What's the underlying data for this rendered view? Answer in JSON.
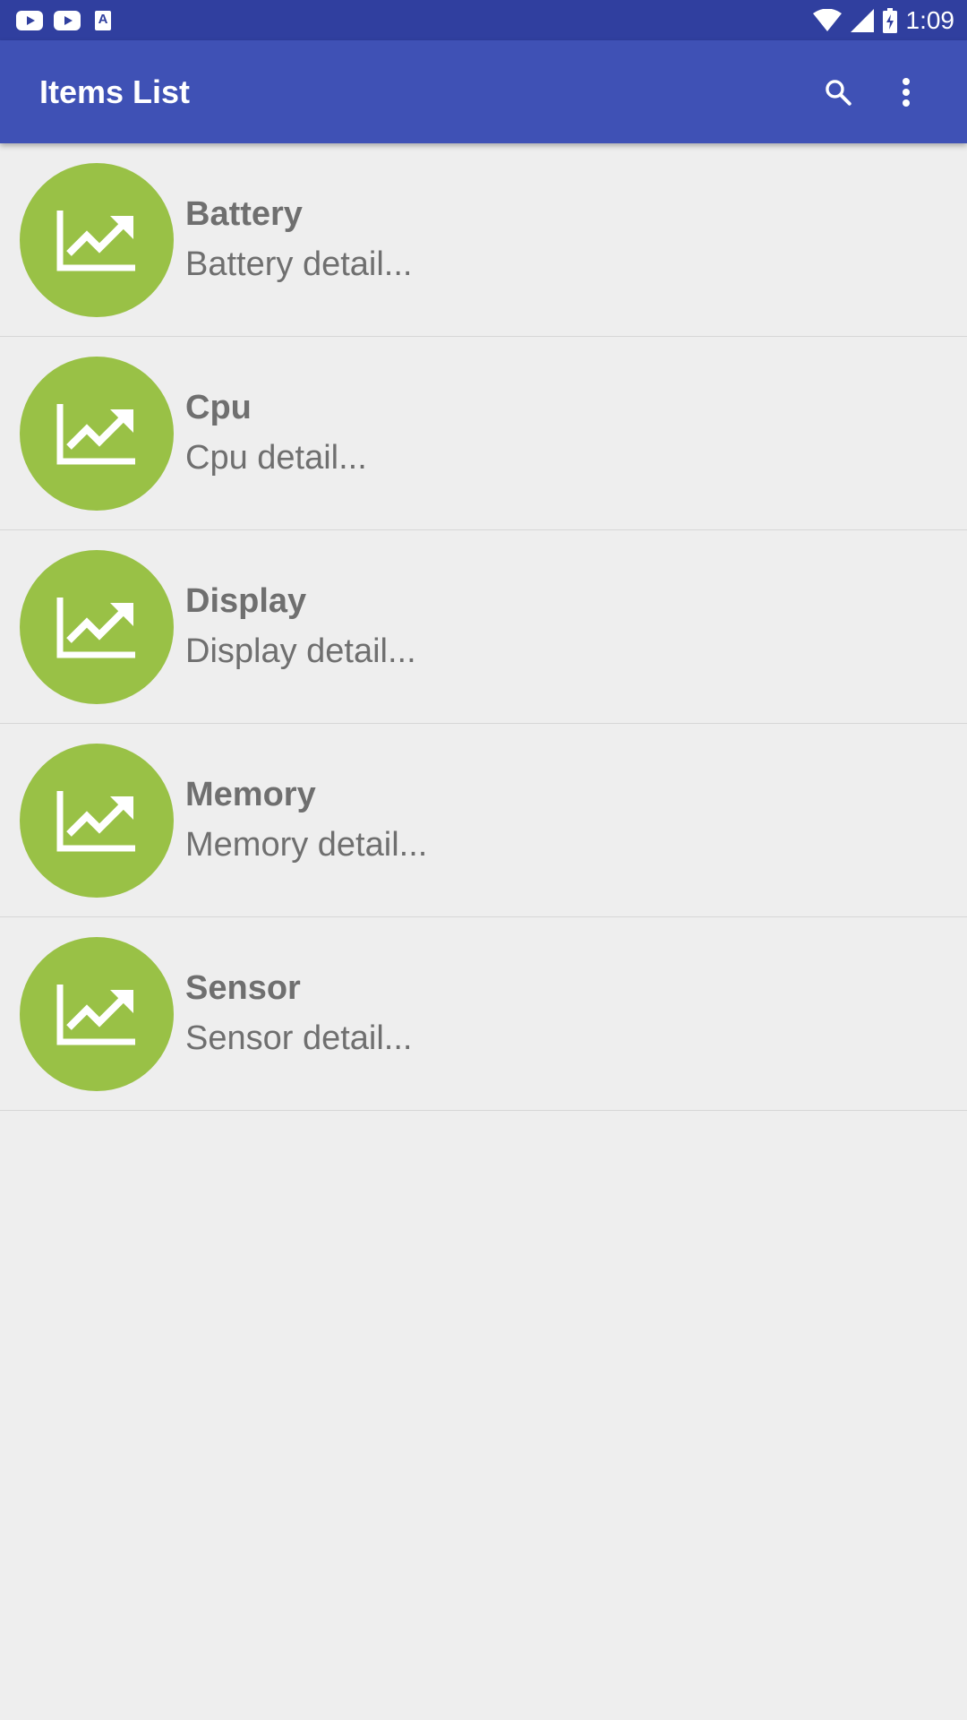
{
  "status_bar": {
    "time": "1:09",
    "left_icons": [
      "youtube-icon",
      "youtube-icon",
      "text-a-icon"
    ],
    "right_icons": [
      "wifi-icon",
      "signal-icon",
      "battery-charging-icon"
    ]
  },
  "app_bar": {
    "title": "Items List",
    "actions": [
      "search-icon",
      "more-vert-icon"
    ],
    "color": "#3f51b5",
    "status_color": "#303f9f"
  },
  "list": {
    "avatar_color": "#99c146",
    "avatar_icon": "trending-up-chart-icon",
    "items": [
      {
        "title": "Battery",
        "detail": "Battery detail..."
      },
      {
        "title": "Cpu",
        "detail": "Cpu detail..."
      },
      {
        "title": "Display",
        "detail": "Display detail..."
      },
      {
        "title": "Memory",
        "detail": "Memory detail..."
      },
      {
        "title": "Sensor",
        "detail": "Sensor detail..."
      }
    ]
  }
}
